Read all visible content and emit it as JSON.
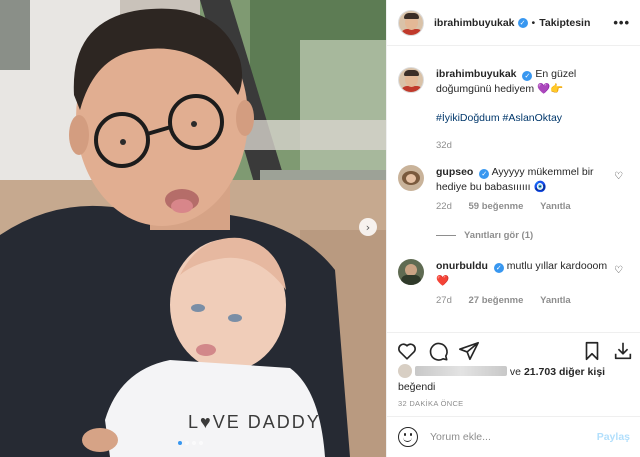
{
  "header": {
    "username": "ibrahimbuyukak",
    "separator": "•",
    "follow_label": "Takiptesin",
    "more_icon": "more-horizontal-icon"
  },
  "caption": {
    "username": "ibrahimbuyukak",
    "text": "En güzel doğumgünü hediyem",
    "emojis": "💜👉",
    "hashtags": "#İyikiDoğdum #AslanOktay",
    "age": "32d"
  },
  "comments": [
    {
      "username": "gupseo",
      "text": "Ayyyyy mükemmel bir hediye bu babasıııııı",
      "emoji": "🧿",
      "age": "22d",
      "likes": "59 beğenme",
      "reply": "Yanıtla"
    },
    {
      "username": "onurbuldu",
      "text": "mutlu yıllar kardooom",
      "emoji": "❤️",
      "age": "27d",
      "likes": "27 beğenme",
      "reply": "Yanıtla"
    }
  ],
  "view_replies": "Yanıtları gör (1)",
  "likes_line": {
    "prefix": "ve",
    "count": "21.703 diğer kişi",
    "suffix": "beğendi"
  },
  "timestamp": "32 DAKİKA ÖNCE",
  "comment_box": {
    "placeholder": "Yorum ekle...",
    "post_label": "Paylaş"
  },
  "carousel": {
    "next_glyph": "›"
  },
  "photo_text": {
    "shirt": "L♥VE DADDY"
  },
  "colors": {
    "accent": "#3897f0",
    "link": "#00376b",
    "muted": "#8e8e8e",
    "post_disabled": "#b2dffc"
  }
}
